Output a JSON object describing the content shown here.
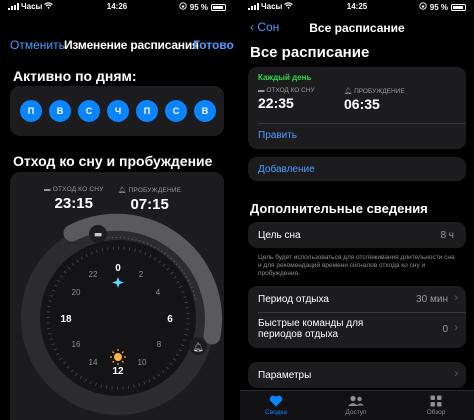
{
  "left": {
    "status": {
      "carrier": "Часы",
      "time": "14:26",
      "battery": "95 %"
    },
    "nav": {
      "cancel": "Отменить",
      "title": "Изменение расписания",
      "done": "Готово"
    },
    "days_title": "Активно по дням:",
    "days": [
      "П",
      "В",
      "С",
      "Ч",
      "П",
      "С",
      "В"
    ],
    "sleep_title": "Отход ко сну и пробуждение",
    "bedtime": {
      "label": "ОТХОД КО СНУ",
      "value": "23:15"
    },
    "wake": {
      "label": "ПРОБУЖДЕНИЕ",
      "value": "07:15"
    },
    "dial_numbers": {
      "top": "0",
      "tr": "2",
      "r1": "4",
      "right": "6",
      "r2": "8",
      "br": "10",
      "bottom": "12",
      "bl": "14",
      "l1": "16",
      "left": "18",
      "l2": "20",
      "tl": "22"
    }
  },
  "right": {
    "status": {
      "carrier": "Часы",
      "time": "14:25",
      "battery": "95 %"
    },
    "nav": {
      "back": "Сон",
      "title": "Все расписание"
    },
    "page_title": "Все расписание",
    "schedule": {
      "days": "Каждый день",
      "bedtime_label": "ОТХОД КО СНУ",
      "bedtime": "22:35",
      "wake_label": "ПРОБУЖДЕНИЕ",
      "wake": "06:35",
      "edit": "Править"
    },
    "add": "Добавление",
    "extra_title": "Дополнительные сведения",
    "sleep_goal": {
      "label": "Цель сна",
      "value": "8 ч"
    },
    "note": "Цель будет использоваться для отслеживания длительности сна и для рекомендаций времени сигналов отхода ко сну и пробуждения.",
    "wind_down": {
      "label": "Период отдыха",
      "value": "30 мин"
    },
    "shortcuts": {
      "label1": "Быстрые команды для",
      "label2": "периодов отдыха",
      "value": "0"
    },
    "options": {
      "label": "Параметры"
    },
    "tabs": [
      {
        "label": "Сводка",
        "active": true
      },
      {
        "label": "Доступ",
        "active": false
      },
      {
        "label": "Обзор",
        "active": false
      }
    ]
  },
  "colors": {
    "accent": "#0a84ff",
    "green": "#32d74b",
    "card": "#1c1c1e",
    "orange": "#ffb340"
  }
}
